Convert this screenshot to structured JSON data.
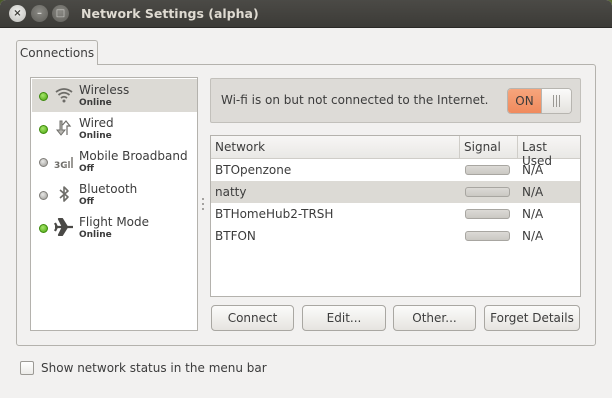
{
  "window": {
    "title": "Network Settings (alpha)",
    "close_glyph": "×",
    "minimize_glyph": "–",
    "maximize_glyph": "□"
  },
  "tabs": [
    {
      "label": "Connections",
      "selected": true
    }
  ],
  "devices": [
    {
      "name": "Wireless",
      "status": "Online",
      "icon": "wifi-icon",
      "indicator": "green",
      "selected": true
    },
    {
      "name": "Wired",
      "status": "Online",
      "icon": "ethernet-icon",
      "indicator": "green",
      "selected": false
    },
    {
      "name": "Mobile Broadband",
      "status": "Off",
      "icon": "mobile-broadband-icon",
      "indicator": "grey",
      "selected": false
    },
    {
      "name": "Bluetooth",
      "status": "Off",
      "icon": "bluetooth-icon",
      "indicator": "grey",
      "selected": false
    },
    {
      "name": "Flight Mode",
      "status": "Online",
      "icon": "airplane-icon",
      "indicator": "green",
      "selected": false
    }
  ],
  "wifi_status": {
    "message": "Wi-fi is on but not connected to the Internet.",
    "toggle_label": "ON",
    "toggle_on": true,
    "toggle_color": "#f08a5d"
  },
  "network_table": {
    "headers": {
      "network": "Network",
      "signal": "Signal",
      "last_used": "Last Used"
    },
    "rows": [
      {
        "network": "BTOpenzone",
        "last_used": "N/A",
        "selected": false
      },
      {
        "network": "natty",
        "last_used": "N/A",
        "selected": true
      },
      {
        "network": "BTHomeHub2-TRSH",
        "last_used": "N/A",
        "selected": false
      },
      {
        "network": "BTFON",
        "last_used": "N/A",
        "selected": false
      }
    ]
  },
  "actions": {
    "connect": "Connect",
    "edit": "Edit...",
    "other": "Other...",
    "forget": "Forget Details"
  },
  "footer": {
    "show_status_label": "Show network status in the menu bar",
    "show_status_checked": false
  },
  "colors": {
    "online_indicator": "#4aa50f",
    "off_indicator": "#9c9a96",
    "titlebar": "#3c3b37",
    "selection": "#dcdad5"
  }
}
